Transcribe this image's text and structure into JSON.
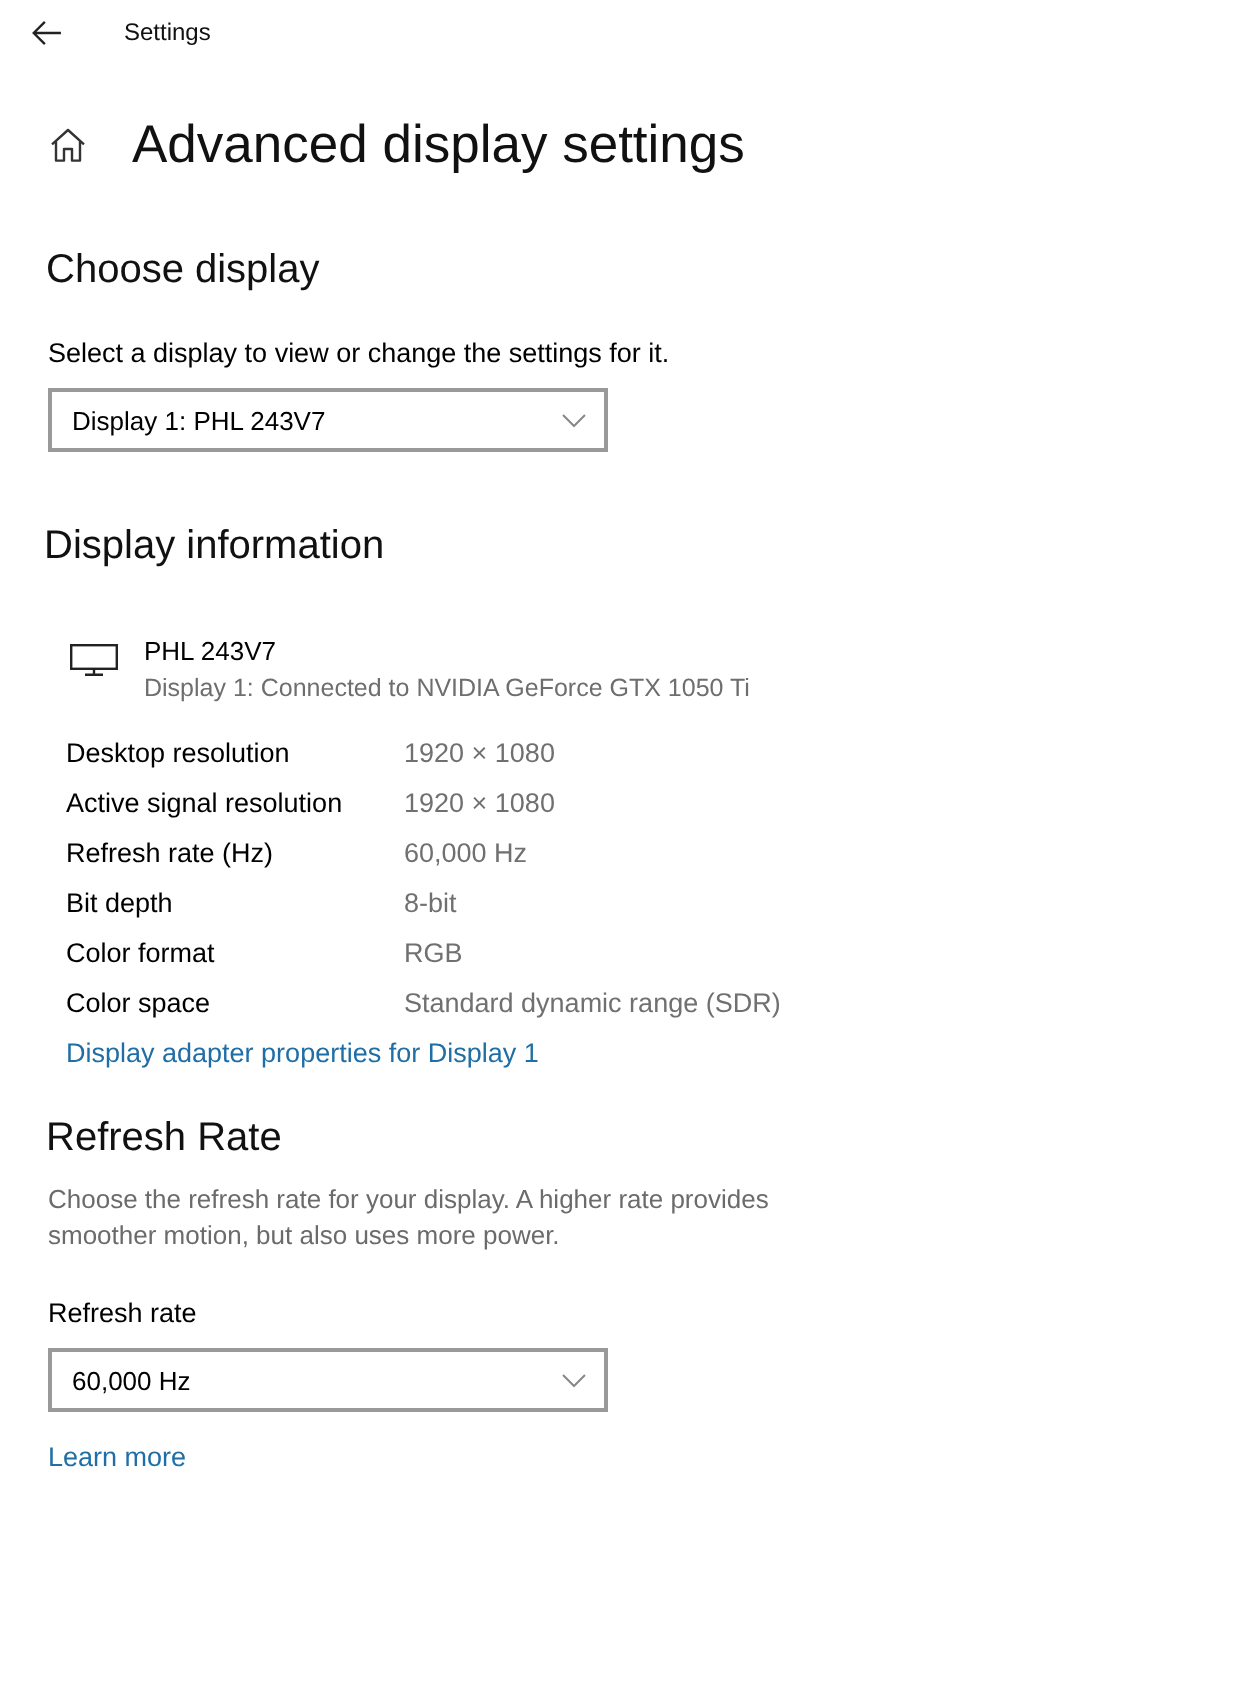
{
  "window": {
    "title": "Settings"
  },
  "page": {
    "title": "Advanced display settings"
  },
  "choose_display": {
    "heading": "Choose display",
    "prompt": "Select a display to view or change the settings for it.",
    "dropdown": {
      "value": "Display 1: PHL 243V7"
    }
  },
  "display_information": {
    "heading": "Display information",
    "monitor": {
      "name": "PHL 243V7",
      "detail": "Display 1: Connected to NVIDIA GeForce GTX 1050 Ti"
    },
    "rows": [
      {
        "label": "Desktop resolution",
        "value": "1920 × 1080"
      },
      {
        "label": "Active signal resolution",
        "value": "1920 × 1080"
      },
      {
        "label": "Refresh rate (Hz)",
        "value": "60,000 Hz"
      },
      {
        "label": "Bit depth",
        "value": "8-bit"
      },
      {
        "label": "Color format",
        "value": "RGB"
      },
      {
        "label": "Color space",
        "value": "Standard dynamic range (SDR)"
      }
    ],
    "link": "Display adapter properties for Display 1"
  },
  "refresh_rate": {
    "heading": "Refresh Rate",
    "description": "Choose the refresh rate for your display. A higher rate provides smoother motion, but also uses more power.",
    "field_label": "Refresh rate",
    "dropdown": {
      "value": "60,000 Hz"
    },
    "link": "Learn more"
  }
}
